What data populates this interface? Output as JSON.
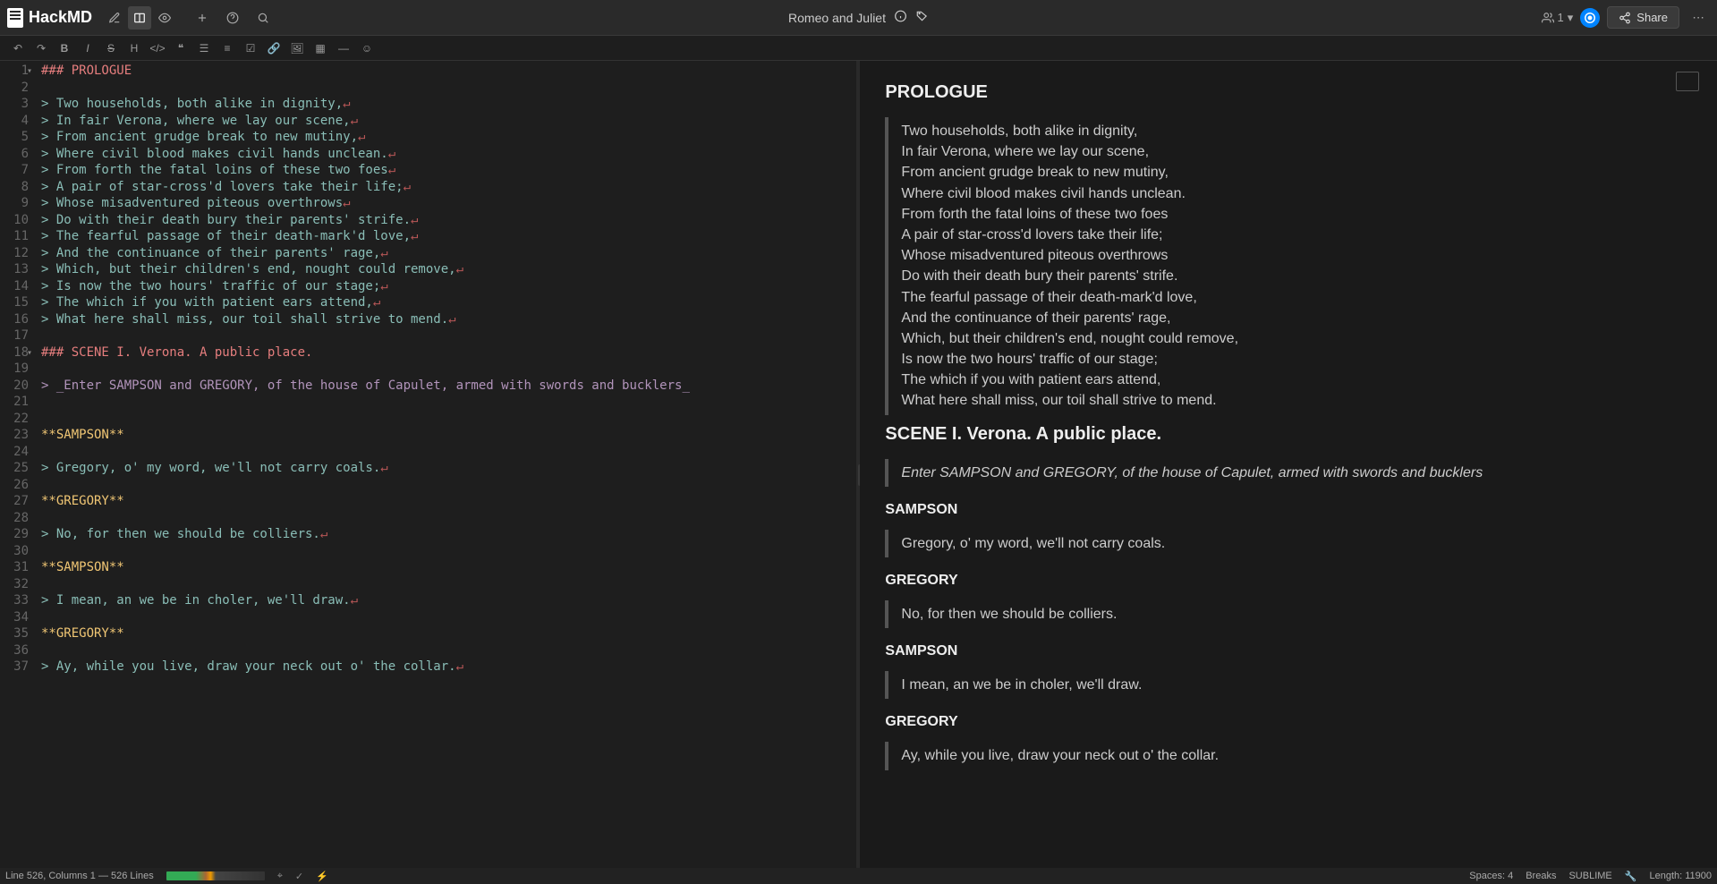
{
  "app": {
    "name": "HackMD"
  },
  "doc": {
    "title": "Romeo and Juliet"
  },
  "online": {
    "count": "1"
  },
  "share": {
    "label": "Share"
  },
  "editor": {
    "lines": [
      {
        "n": "1",
        "type": "h",
        "hash": "### ",
        "text": "PROLOGUE",
        "eol": ""
      },
      {
        "n": "2",
        "type": "blank"
      },
      {
        "n": "3",
        "type": "q",
        "text": "> Two households, both alike in dignity,",
        "eol": "↵"
      },
      {
        "n": "4",
        "type": "q",
        "text": "> In fair Verona, where we lay our scene,",
        "eol": "↵"
      },
      {
        "n": "5",
        "type": "q",
        "text": "> From ancient grudge break to new mutiny,",
        "eol": "↵"
      },
      {
        "n": "6",
        "type": "q",
        "text": "> Where civil blood makes civil hands unclean.",
        "eol": "↵"
      },
      {
        "n": "7",
        "type": "q",
        "text": "> From forth the fatal loins of these two foes",
        "eol": "↵"
      },
      {
        "n": "8",
        "type": "q",
        "text": "> A pair of star-cross'd lovers take their life;",
        "eol": "↵"
      },
      {
        "n": "9",
        "type": "q",
        "text": "> Whose misadventured piteous overthrows",
        "eol": "↵"
      },
      {
        "n": "10",
        "type": "q",
        "text": "> Do with their death bury their parents' strife.",
        "eol": "↵"
      },
      {
        "n": "11",
        "type": "q",
        "text": "> The fearful passage of their death-mark'd love,",
        "eol": "↵"
      },
      {
        "n": "12",
        "type": "q",
        "text": "> And the continuance of their parents' rage,",
        "eol": "↵"
      },
      {
        "n": "13",
        "type": "q",
        "text": "> Which, but their children's end, nought could remove,",
        "eol": "↵"
      },
      {
        "n": "14",
        "type": "q",
        "text": "> Is now the two hours' traffic of our stage;",
        "eol": "↵"
      },
      {
        "n": "15",
        "type": "q",
        "text": "> The which if you with patient ears attend,",
        "eol": "↵"
      },
      {
        "n": "16",
        "type": "q",
        "text": "> What here shall miss, our toil shall strive to mend.",
        "eol": "↵"
      },
      {
        "n": "17",
        "type": "blank"
      },
      {
        "n": "18",
        "type": "h",
        "hash": "### ",
        "text": "SCENE I. Verona. A public place.",
        "eol": ""
      },
      {
        "n": "19",
        "type": "blank"
      },
      {
        "n": "20",
        "type": "i",
        "text": "> _Enter SAMPSON and GREGORY, of the house of Capulet, armed with swords and bucklers_",
        "wrap": true
      },
      {
        "n": "21",
        "type": "blank"
      },
      {
        "n": "22",
        "type": "b",
        "text": "**SAMPSON**"
      },
      {
        "n": "23",
        "type": "blank"
      },
      {
        "n": "24",
        "type": "q",
        "text": "> Gregory, o' my word, we'll not carry coals.",
        "eol": "↵"
      },
      {
        "n": "25",
        "type": "blank"
      },
      {
        "n": "26",
        "type": "b",
        "text": "**GREGORY**"
      },
      {
        "n": "27",
        "type": "blank"
      },
      {
        "n": "28",
        "type": "q",
        "text": "> No, for then we should be colliers.",
        "eol": "↵"
      },
      {
        "n": "29",
        "type": "blank"
      },
      {
        "n": "30",
        "type": "b",
        "text": "**SAMPSON**"
      },
      {
        "n": "31",
        "type": "blank"
      },
      {
        "n": "32",
        "type": "q",
        "text": "> I mean, an we be in choler, we'll draw.",
        "eol": "↵"
      },
      {
        "n": "33",
        "type": "blank"
      },
      {
        "n": "34",
        "type": "b",
        "text": "**GREGORY**"
      },
      {
        "n": "35",
        "type": "blank"
      },
      {
        "n": "36",
        "type": "q",
        "text": "> Ay, while you live, draw your neck out o' the collar.",
        "eol": "↵"
      },
      {
        "n": "37",
        "type": "blank"
      }
    ]
  },
  "preview": {
    "h1": "PROLOGUE",
    "prologue": "Two households, both alike in dignity,\nIn fair Verona, where we lay our scene,\nFrom ancient grudge break to new mutiny,\nWhere civil blood makes civil hands unclean.\nFrom forth the fatal loins of these two foes\nA pair of star-cross'd lovers take their life;\nWhose misadventured piteous overthrows\nDo with their death bury their parents' strife.\nThe fearful passage of their death-mark'd love,\nAnd the continuance of their parents' rage,\nWhich, but their children's end, nought could remove,\nIs now the two hours' traffic of our stage;\nThe which if you with patient ears attend,\nWhat here shall miss, our toil shall strive to mend.",
    "h2": "SCENE I. Verona. A public place.",
    "stage": "Enter SAMPSON and GREGORY, of the house of Capulet, armed with swords and bucklers",
    "s1": "SAMPSON",
    "q1": "Gregory, o' my word, we'll not carry coals.",
    "s2": "GREGORY",
    "q2": "No, for then we should be colliers.",
    "s3": "SAMPSON",
    "q3": "I mean, an we be in choler, we'll draw.",
    "s4": "GREGORY",
    "q4": "Ay, while you live, draw your neck out o' the collar."
  },
  "status": {
    "pos": "Line 526, Columns 1 — 526 Lines",
    "spaces": "Spaces: 4",
    "breaks": "Breaks",
    "keymap": "SUBLIME",
    "length": "Length: 11900"
  }
}
